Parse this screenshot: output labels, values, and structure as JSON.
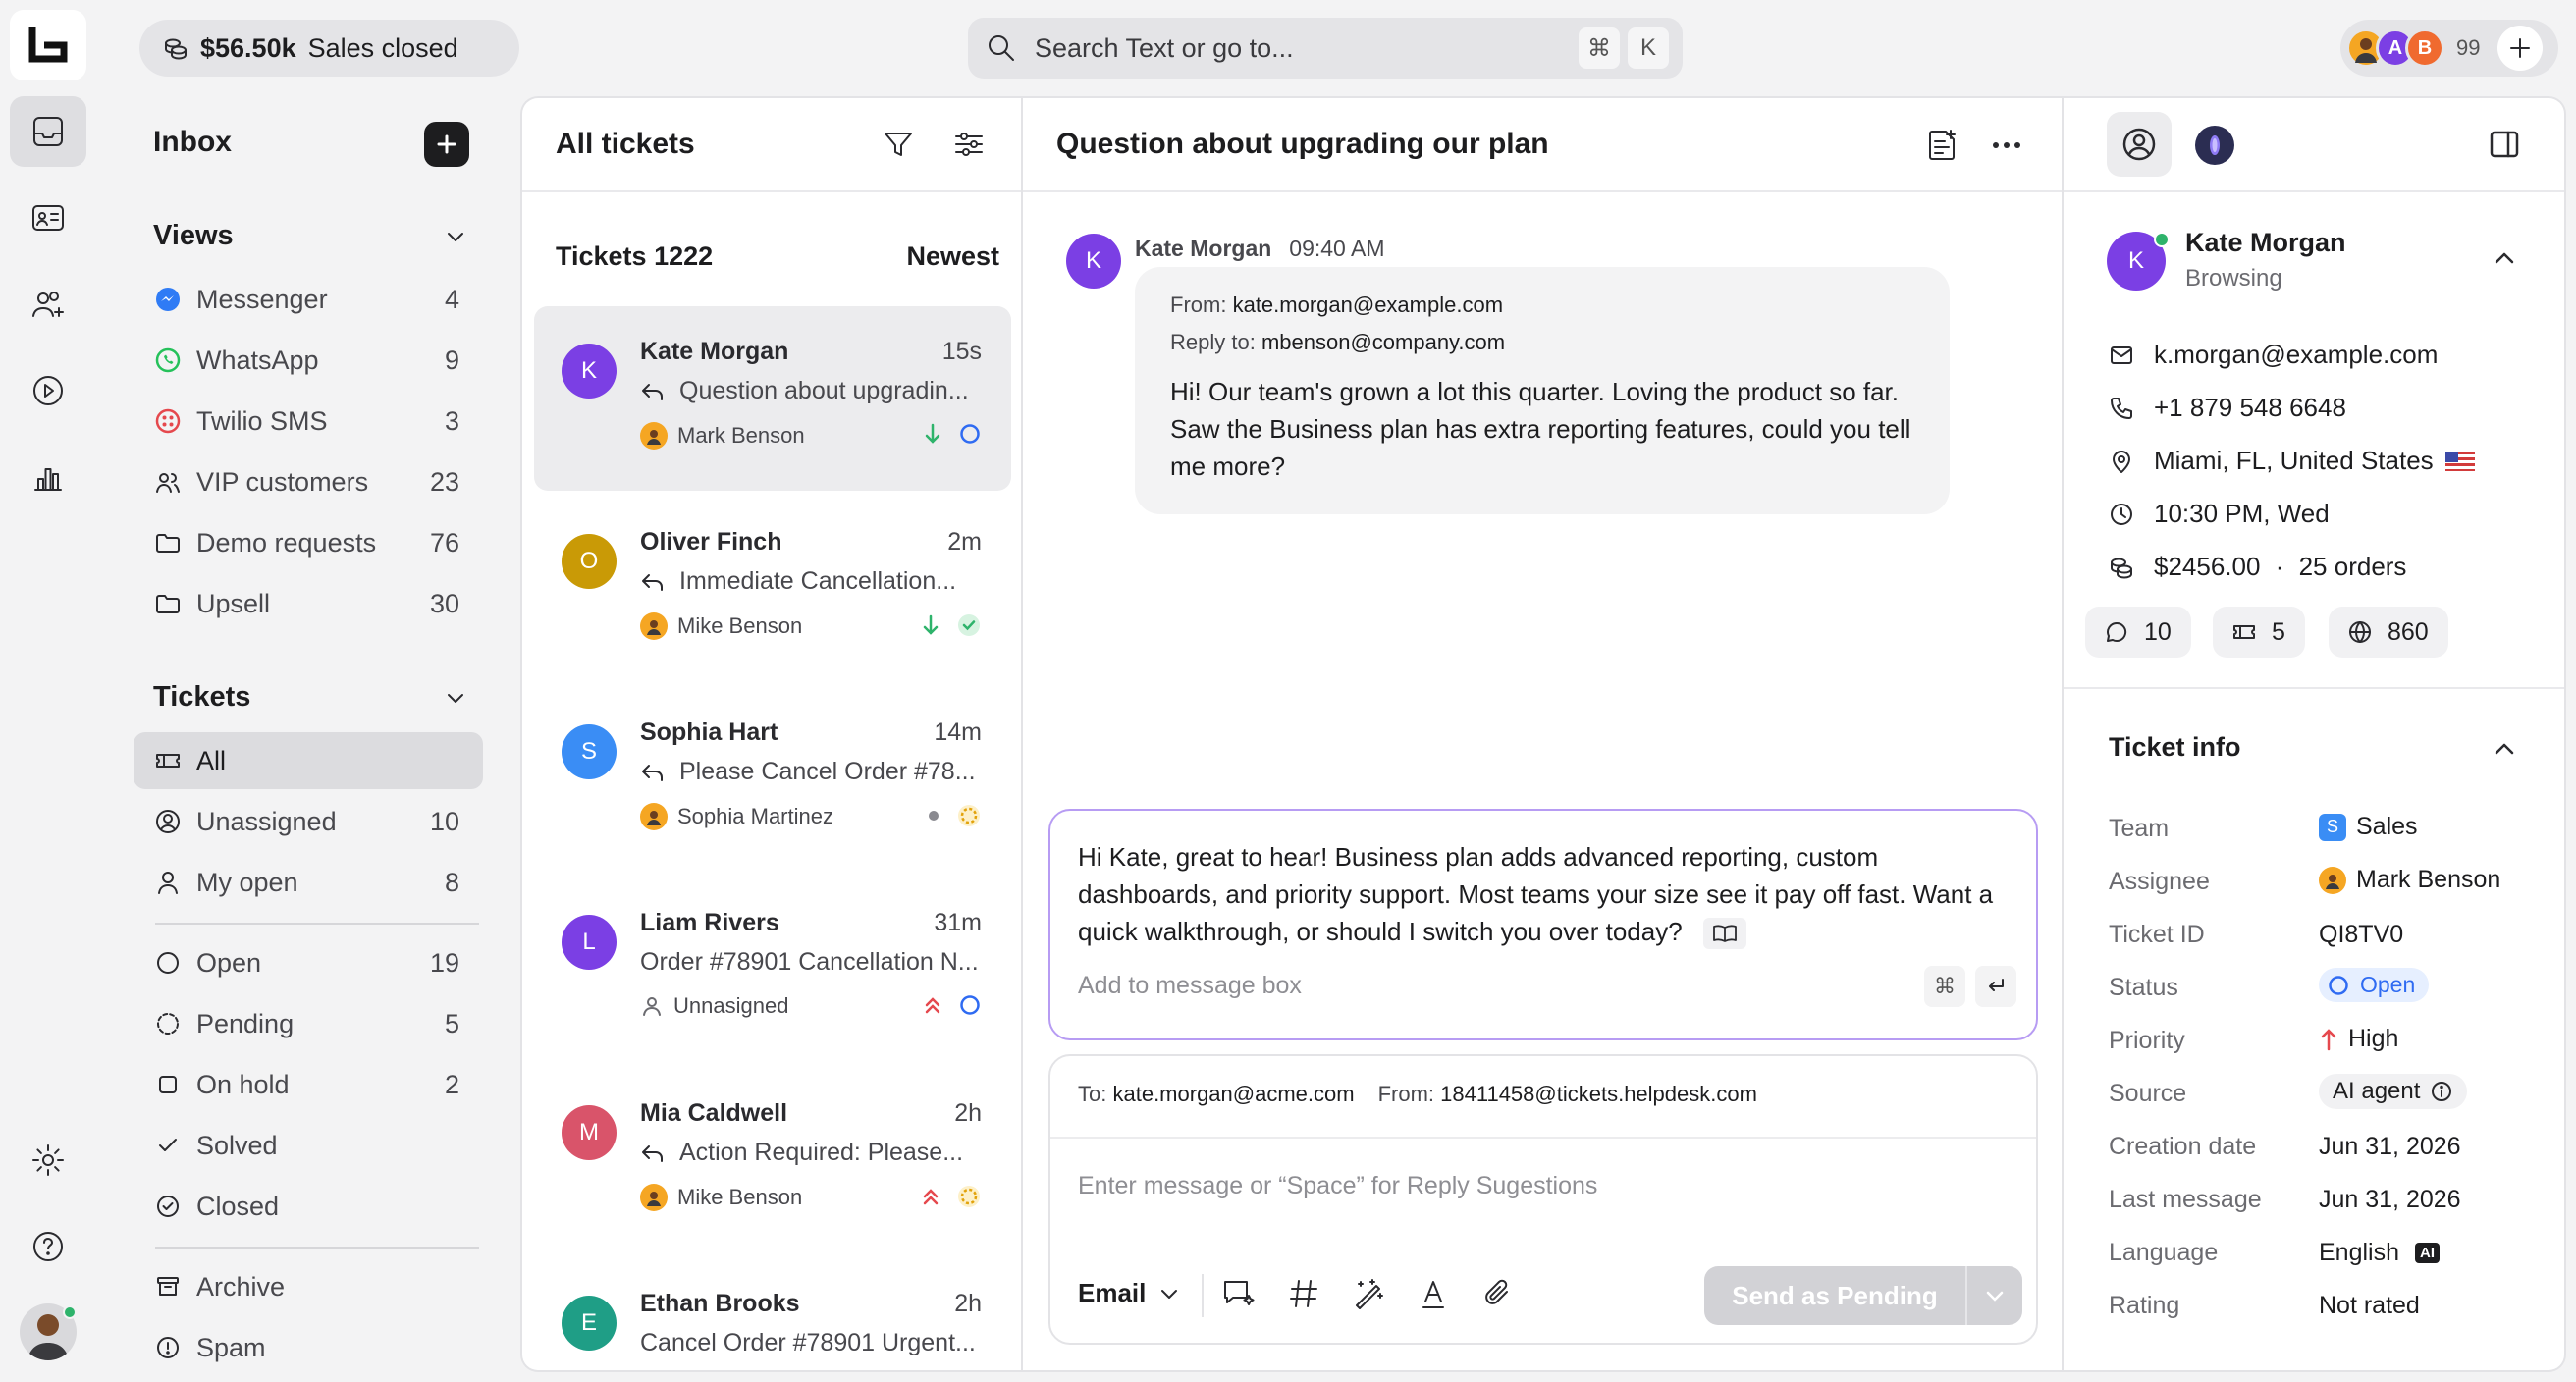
{
  "topbar": {
    "sales_amount": "$56.50k",
    "sales_label": "Sales closed",
    "search_placeholder": "Search Text or go to...",
    "shortcut_cmd": "⌘",
    "shortcut_key": "K",
    "presence_letters": [
      "A",
      "B"
    ],
    "presence_count": "99"
  },
  "sidebar": {
    "title": "Inbox",
    "views_title": "Views",
    "views": [
      {
        "label": "Messenger",
        "count": "4"
      },
      {
        "label": "WhatsApp",
        "count": "9"
      },
      {
        "label": "Twilio SMS",
        "count": "3"
      },
      {
        "label": "VIP customers",
        "count": "23"
      },
      {
        "label": "Demo requests",
        "count": "76"
      },
      {
        "label": "Upsell",
        "count": "30"
      }
    ],
    "tickets_title": "Tickets",
    "ticket_filters": [
      {
        "label": "All",
        "count": ""
      },
      {
        "label": "Unassigned",
        "count": "10"
      },
      {
        "label": "My open",
        "count": "8"
      }
    ],
    "statuses": [
      {
        "label": "Open",
        "count": "19"
      },
      {
        "label": "Pending",
        "count": "5"
      },
      {
        "label": "On hold",
        "count": "2"
      },
      {
        "label": "Solved",
        "count": ""
      },
      {
        "label": "Closed",
        "count": ""
      }
    ],
    "extras": [
      {
        "label": "Archive"
      },
      {
        "label": "Spam"
      }
    ]
  },
  "list": {
    "title": "All tickets",
    "count_label": "Tickets 1222",
    "sort_label": "Newest",
    "tickets": [
      {
        "initial": "K",
        "color": "#7b3fe4",
        "name": "Kate Morgan",
        "time": "15s",
        "subject": "Question about upgradin...",
        "agent": "Mark Benson"
      },
      {
        "initial": "O",
        "color": "#c99a06",
        "name": "Oliver Finch",
        "time": "2m",
        "subject": "Immediate Cancellation...",
        "agent": "Mike Benson"
      },
      {
        "initial": "S",
        "color": "#3a8df5",
        "name": "Sophia Hart",
        "time": "14m",
        "subject": "Please Cancel Order #78...",
        "agent": "Sophia Martinez"
      },
      {
        "initial": "L",
        "color": "#7b3fe4",
        "name": "Liam Rivers",
        "time": "31m",
        "subject": "Order #78901 Cancellation N...",
        "agent": "Unnasigned"
      },
      {
        "initial": "M",
        "color": "#d9546a",
        "name": "Mia Caldwell",
        "time": "2h",
        "subject": "Action Required: Please...",
        "agent": "Mike Benson"
      },
      {
        "initial": "E",
        "color": "#1f9e86",
        "name": "Ethan Brooks",
        "time": "2h",
        "subject": "Cancel Order #78901 Urgent...",
        "agent": ""
      }
    ]
  },
  "conversation": {
    "title": "Question about upgrading our plan",
    "sender_initial": "K",
    "sender_name": "Kate Morgan",
    "sent_time": "09:40 AM",
    "from_label": "From:",
    "from_value": "kate.morgan@example.com",
    "reply_label": "Reply to:",
    "reply_value": "mbenson@company.com",
    "message": "Hi! Our team's grown a lot this quarter. Loving the product so far. Saw the Business plan has extra reporting features, could you tell me more?",
    "suggestion": "Hi Kate, great to hear! Business plan adds advanced reporting, custom dashboards, and priority support. Most teams your size see it pay off fast. Want a quick walkthrough, or should I switch you over today?",
    "add_placeholder": "Add to message box",
    "to_label": "To:",
    "to_value": "kate.morgan@acme.com",
    "from2_label": "From:",
    "from2_value": "18411458@tickets.helpdesk.com",
    "reply_placeholder": "Enter message or “Space” for Reply Sugestions",
    "channel": "Email",
    "send_label": "Send as Pending"
  },
  "contact": {
    "initial": "K",
    "name": "Kate Morgan",
    "status": "Browsing",
    "email": "k.morgan@example.com",
    "phone": "+1 879 548 6648",
    "location": "Miami, FL, United States",
    "local_time": "10:30 PM, Wed",
    "spend": "$2456.00",
    "orders": "25 orders",
    "chats": "10",
    "tickets": "5",
    "visits": "860"
  },
  "ticket_info": {
    "title": "Ticket info",
    "rows": [
      {
        "label": "Team",
        "value": "Sales",
        "badge": "S"
      },
      {
        "label": "Assignee",
        "value": "Mark Benson"
      },
      {
        "label": "Ticket ID",
        "value": "QI8TV0"
      },
      {
        "label": "Status",
        "value": "Open"
      },
      {
        "label": "Priority",
        "value": "High"
      },
      {
        "label": "Source",
        "value": "AI agent"
      },
      {
        "label": "Creation date",
        "value": "Jun 31, 2026"
      },
      {
        "label": "Last message",
        "value": "Jun 31, 2026"
      },
      {
        "label": "Language",
        "value": "English",
        "badge": "AI"
      },
      {
        "label": "Rating",
        "value": "Not rated"
      }
    ]
  },
  "colors": {
    "accent_purple": "#7b3fe4",
    "status_blue": "#2f6bf2",
    "priority_red": "#e5484d",
    "success_green": "#2eb36b"
  }
}
